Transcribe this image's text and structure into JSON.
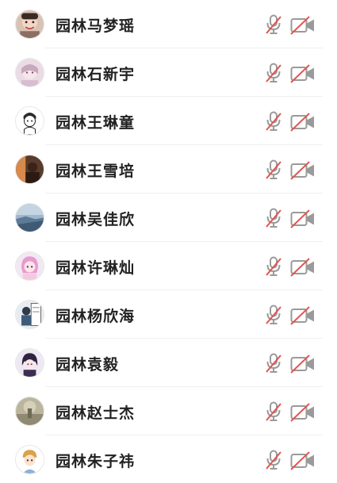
{
  "participants": [
    {
      "name": "园林马梦瑶",
      "avatar": "child-photo-avatar",
      "mic": "muted",
      "camera": "off"
    },
    {
      "name": "园林石新宇",
      "avatar": "pink-girl-avatar",
      "mic": "muted",
      "camera": "off"
    },
    {
      "name": "园林王琳童",
      "avatar": "cartoon-sketch-avatar",
      "mic": "muted",
      "camera": "off"
    },
    {
      "name": "园林王雪培",
      "avatar": "dark-portrait-avatar",
      "mic": "muted",
      "camera": "off"
    },
    {
      "name": "园林吴佳欣",
      "avatar": "blue-landscape-avatar",
      "mic": "muted",
      "camera": "off"
    },
    {
      "name": "园林许琳灿",
      "avatar": "anime-pink-hair-avatar",
      "mic": "muted",
      "camera": "off"
    },
    {
      "name": "园林杨欣海",
      "avatar": "comic-figure-avatar",
      "mic": "muted",
      "camera": "off"
    },
    {
      "name": "园林袁毅",
      "avatar": "anime-dark-hair-avatar",
      "mic": "muted",
      "camera": "off"
    },
    {
      "name": "园林赵士杰",
      "avatar": "foggy-scene-avatar",
      "mic": "muted",
      "camera": "off"
    },
    {
      "name": "园林朱子祎",
      "avatar": "cartoon-boy-avatar",
      "mic": "muted",
      "camera": "off"
    }
  ],
  "colors": {
    "icon_gray": "#9a9a9a",
    "slash_red": "#e0554e",
    "name_text": "#222222",
    "divider": "#efefef"
  }
}
